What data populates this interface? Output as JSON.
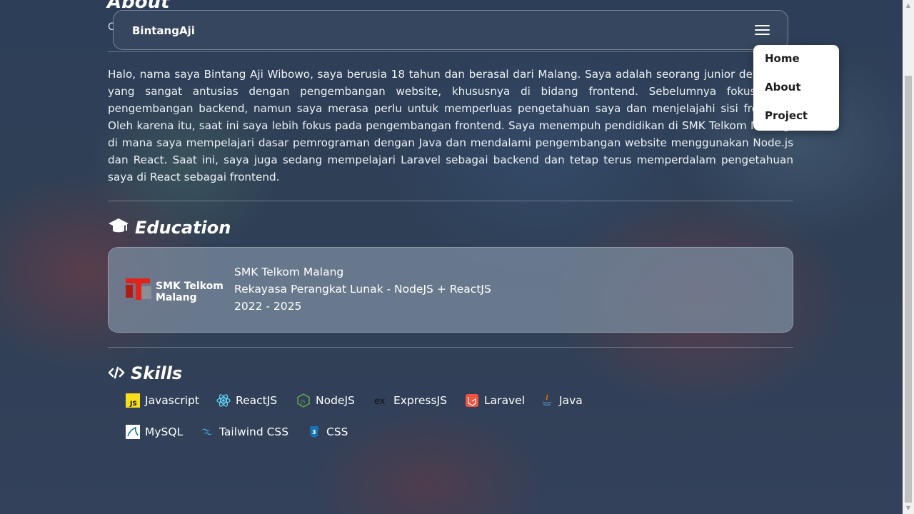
{
  "about": {
    "heading": "About",
    "subtitle": "C",
    "paragraph": "Halo, nama saya Bintang Aji Wibowo, saya berusia 18 tahun dan berasal dari Malang. Saya adalah seorang junior developer yang sangat antusias dengan pengembangan website, khususnya di bidang frontend. Sebelumnya fokus pada pengembangan backend, namun saya merasa perlu untuk memperluas pengetahuan saya dan menjelajahi sisi frontend. Oleh karena itu, saat ini saya lebih fokus pada pengembangan frontend. Saya menempuh pendidikan di SMK Telkom Malang, di mana saya mempelajari dasar pemrograman dengan Java dan mendalami pengembangan website menggunakan Node.js dan React. Saat ini, saya juga sedang mempelajari Laravel sebagai backend dan tetap terus memperdalam pengetahuan saya di React sebagai frontend."
  },
  "navbar": {
    "brand": "BintangAji",
    "menu_icon": "hamburger-menu-icon"
  },
  "menu": {
    "items": [
      "Home",
      "About",
      "Project"
    ]
  },
  "education": {
    "title": "Education",
    "icon": "graduation-cap-icon",
    "school": "SMK Telkom Malang",
    "major": "Rekayasa Perangkat Lunak - NodeJS + ReactJS",
    "years": "2022 - 2025",
    "logo_text": [
      "SMK Telkom",
      "Malang"
    ],
    "logo_color": "#e2231a"
  },
  "skills": {
    "title": "Skills",
    "icon": "code-icon",
    "items": [
      {
        "label": "Javascript",
        "icon": "javascript-icon"
      },
      {
        "label": "ReactJS",
        "icon": "react-icon"
      },
      {
        "label": "NodeJS",
        "icon": "nodejs-icon"
      },
      {
        "label": "ExpressJS",
        "icon": "express-icon"
      },
      {
        "label": "Laravel",
        "icon": "laravel-icon"
      },
      {
        "label": "Java",
        "icon": "java-icon"
      },
      {
        "label": "MySQL",
        "icon": "mysql-icon"
      },
      {
        "label": "Tailwind CSS",
        "icon": "tailwind-icon"
      },
      {
        "label": "CSS",
        "icon": "css-icon"
      }
    ]
  }
}
